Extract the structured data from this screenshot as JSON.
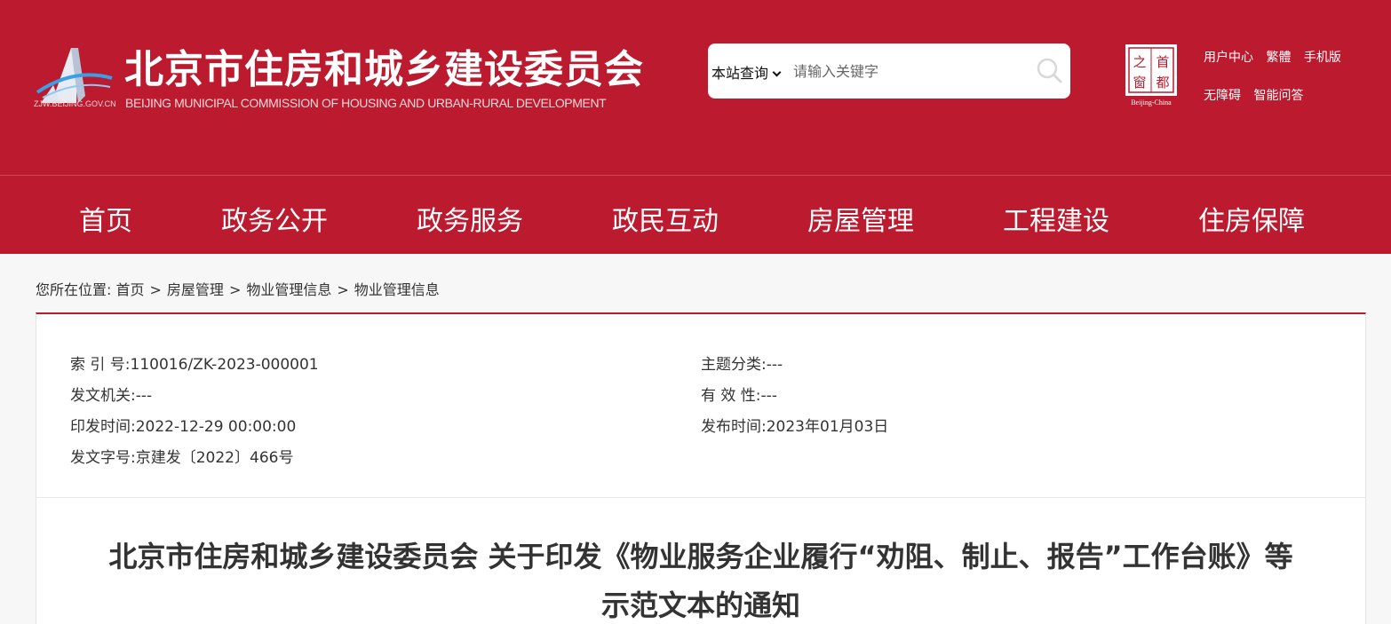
{
  "header": {
    "site_name_cn": "北京市住房和城乡建设委员会",
    "site_name_en": "BEIJING MUNICIPAL COMMISSION OF HOUSING AND URBAN-RURAL DEVELOPMENT",
    "logo_domain": "ZJW.BEIJING.GOV.CN",
    "seal_chars": [
      "之",
      "首",
      "窗",
      "都"
    ],
    "seal_caption": "Beijing-China",
    "links_row1": [
      "用户中心",
      "繁體",
      "手机版"
    ],
    "links_row2": [
      "无障碍",
      "智能问答"
    ]
  },
  "search": {
    "scope": "本站查询",
    "placeholder": "请输入关键字"
  },
  "nav": {
    "items": [
      "首页",
      "政务公开",
      "政务服务",
      "政民互动",
      "房屋管理",
      "工程建设",
      "住房保障"
    ]
  },
  "breadcrumb": {
    "prefix": "您所在位置:",
    "items": [
      "首页",
      "房屋管理",
      "物业管理信息",
      "物业管理信息"
    ],
    "separator": ">"
  },
  "meta": {
    "index_no_label": "索 引 号:",
    "index_no": "110016/ZK-2023-000001",
    "topic_label": "主题分类:",
    "topic": "---",
    "issuer_label": "发文机关:",
    "issuer": "---",
    "validity_label": "有 效 性:",
    "validity": "---",
    "issue_date_label": "印发时间:",
    "issue_date": "2022-12-29 00:00:00",
    "publish_date_label": "发布时间:",
    "publish_date": "2023年01月03日",
    "doc_no_label": "发文字号:",
    "doc_no": "京建发〔2022〕466号"
  },
  "article": {
    "title_line1": "北京市住房和城乡建设委员会 关于印发《物业服务企业履行“劝阻、制止、报告”工作台账》等",
    "title_line2": "示范文本的通知"
  },
  "colors": {
    "brand_red": "#bc1a2e"
  }
}
